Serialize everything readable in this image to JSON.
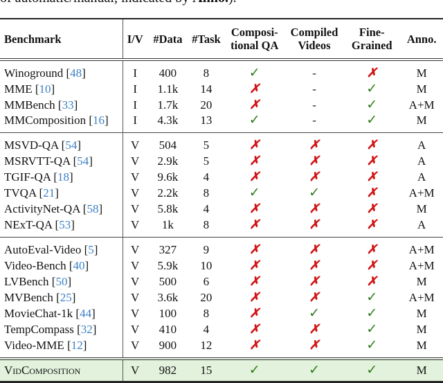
{
  "caption_fragment": {
    "text": "of automatic/manual, indicated by ",
    "bold": "Anno.",
    "end": ")."
  },
  "headers": {
    "benchmark": "Benchmark",
    "iv": "I/V",
    "data": "#Data",
    "task": "#Task",
    "cqa_1": "Composi-",
    "cqa_2": "tional QA",
    "cv_1": "Compiled",
    "cv_2": "Videos",
    "fg_1": "Fine-",
    "fg_2": "Grained",
    "anno": "Anno."
  },
  "symbols": {
    "yes": "✓",
    "no": "✗",
    "na": "-"
  },
  "colors": {
    "check": "#2e7d1a",
    "cross": "#d01515",
    "ref": "#3a7fc4",
    "highlight": "#e2f2dc"
  },
  "groups": [
    {
      "rows": [
        {
          "name": "Winoground",
          "ref": "48",
          "iv": "I",
          "data": "400",
          "task": "8",
          "cqa": "✓",
          "cv": "-",
          "fg": "✗",
          "anno": "M"
        },
        {
          "name": "MME",
          "ref": "10",
          "iv": "I",
          "data": "1.1k",
          "task": "14",
          "cqa": "✗",
          "cv": "-",
          "fg": "✓",
          "anno": "M"
        },
        {
          "name": "MMBench",
          "ref": "33",
          "iv": "I",
          "data": "1.7k",
          "task": "20",
          "cqa": "✗",
          "cv": "-",
          "fg": "✓",
          "anno": "A+M"
        },
        {
          "name": "MMComposition",
          "ref": "16",
          "iv": "I",
          "data": "4.3k",
          "task": "13",
          "cqa": "✓",
          "cv": "-",
          "fg": "✓",
          "anno": "M"
        }
      ]
    },
    {
      "rows": [
        {
          "name": "MSVD-QA",
          "ref": "54",
          "iv": "V",
          "data": "504",
          "task": "5",
          "cqa": "✗",
          "cv": "✗",
          "fg": "✗",
          "anno": "A"
        },
        {
          "name": "MSRVTT-QA",
          "ref": "54",
          "iv": "V",
          "data": "2.9k",
          "task": "5",
          "cqa": "✗",
          "cv": "✗",
          "fg": "✗",
          "anno": "A"
        },
        {
          "name": "TGIF-QA",
          "ref": "18",
          "iv": "V",
          "data": "9.6k",
          "task": "4",
          "cqa": "✗",
          "cv": "✗",
          "fg": "✗",
          "anno": "A"
        },
        {
          "name": "TVQA",
          "ref": "21",
          "iv": "V",
          "data": "2.2k",
          "task": "8",
          "cqa": "✓",
          "cv": "✓",
          "fg": "✗",
          "anno": "A+M"
        },
        {
          "name": "ActivityNet-QA",
          "ref": "58",
          "iv": "V",
          "data": "5.8k",
          "task": "4",
          "cqa": "✗",
          "cv": "✗",
          "fg": "✗",
          "anno": "M"
        },
        {
          "name": "NExT-QA",
          "ref": "53",
          "iv": "V",
          "data": "1k",
          "task": "8",
          "cqa": "✗",
          "cv": "✗",
          "fg": "✗",
          "anno": "A"
        }
      ]
    },
    {
      "rows": [
        {
          "name": "AutoEval-Video",
          "ref": "5",
          "iv": "V",
          "data": "327",
          "task": "9",
          "cqa": "✗",
          "cv": "✗",
          "fg": "✗",
          "anno": "A+M"
        },
        {
          "name": "Video-Bench",
          "ref": "40",
          "iv": "V",
          "data": "5.9k",
          "task": "10",
          "cqa": "✗",
          "cv": "✗",
          "fg": "✗",
          "anno": "A+M"
        },
        {
          "name": "LVBench",
          "ref": "50",
          "iv": "V",
          "data": "500",
          "task": "6",
          "cqa": "✗",
          "cv": "✗",
          "fg": "✗",
          "anno": "M"
        },
        {
          "name": "MVBench",
          "ref": "25",
          "iv": "V",
          "data": "3.6k",
          "task": "20",
          "cqa": "✗",
          "cv": "✗",
          "fg": "✓",
          "anno": "A+M"
        },
        {
          "name": "MovieChat-1k",
          "ref": "44",
          "iv": "V",
          "data": "100",
          "task": "8",
          "cqa": "✗",
          "cv": "✓",
          "fg": "✓",
          "anno": "M"
        },
        {
          "name": "TempCompass",
          "ref": "32",
          "iv": "V",
          "data": "410",
          "task": "4",
          "cqa": "✗",
          "cv": "✗",
          "fg": "✓",
          "anno": "M"
        },
        {
          "name": "Video-MME",
          "ref": "12",
          "iv": "V",
          "data": "900",
          "task": "12",
          "cqa": "✗",
          "cv": "✗",
          "fg": "✓",
          "anno": "M"
        }
      ]
    }
  ],
  "ours": {
    "name": "VidComposition",
    "iv": "V",
    "data": "982",
    "task": "15",
    "cqa": "✓",
    "cv": "✓",
    "fg": "✓",
    "anno": "M"
  }
}
